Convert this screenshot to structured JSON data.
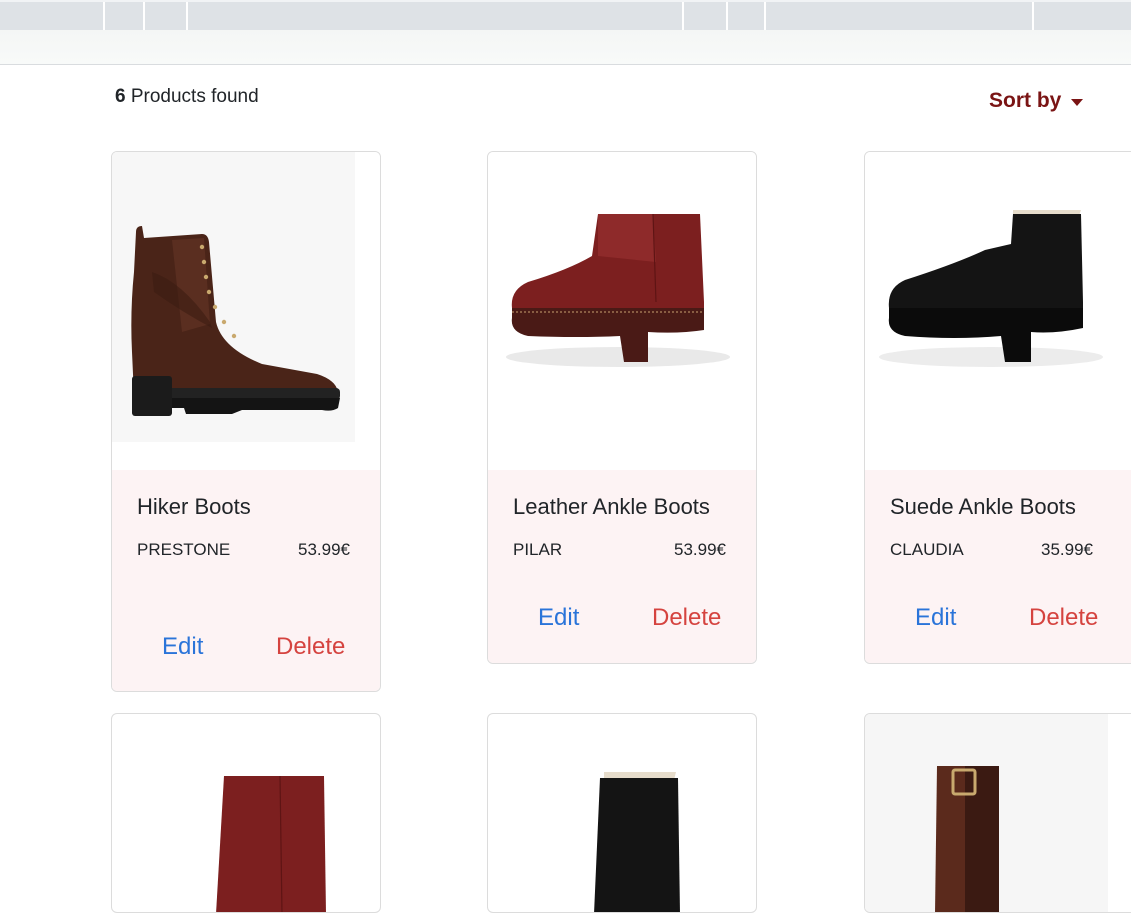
{
  "results": {
    "count": "6",
    "label": "Products found"
  },
  "sort": {
    "label": "Sort by"
  },
  "products": [
    {
      "name": "Hiker Boots",
      "maker": "PRESTONE",
      "price": "53.99€",
      "edit": "Edit",
      "delete": "Delete"
    },
    {
      "name": "Leather Ankle Boots",
      "maker": "PILAR",
      "price": "53.99€",
      "edit": "Edit",
      "delete": "Delete"
    },
    {
      "name": "Suede Ankle Boots",
      "maker": "CLAUDIA",
      "price": "35.99€",
      "edit": "Edit",
      "delete": "Delete"
    }
  ],
  "colors": {
    "accent": "#7a1414",
    "edit": "#2a74d9",
    "delete": "#d5433f",
    "card_body": "#fdf3f4"
  }
}
